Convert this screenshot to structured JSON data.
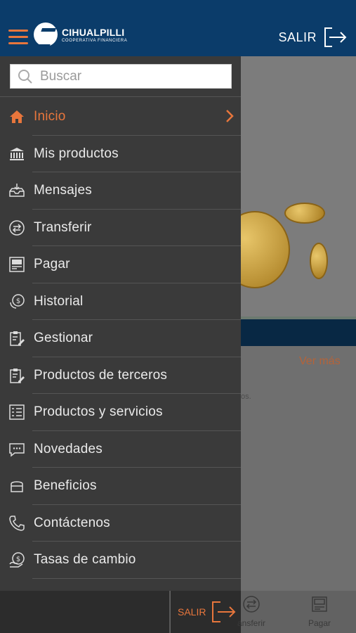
{
  "header": {
    "brand_title": "CIHUALPILLI",
    "brand_subtitle": "COOPERATIVA FINANCIERA",
    "exit_label": "SALIR"
  },
  "search": {
    "placeholder": "Buscar"
  },
  "menu": {
    "items": [
      {
        "label": "Inicio",
        "icon": "home-icon",
        "active": true
      },
      {
        "label": "Mis productos",
        "icon": "bank-icon"
      },
      {
        "label": "Mensajes",
        "icon": "inbox-icon"
      },
      {
        "label": "Transferir",
        "icon": "transfer-icon"
      },
      {
        "label": "Pagar",
        "icon": "pay-icon"
      },
      {
        "label": "Historial",
        "icon": "history-icon"
      },
      {
        "label": "Gestionar",
        "icon": "manage-icon"
      },
      {
        "label": "Productos de terceros",
        "icon": "third-party-icon"
      },
      {
        "label": "Productos y servicios",
        "icon": "services-icon"
      },
      {
        "label": "Novedades",
        "icon": "news-icon"
      },
      {
        "label": "Beneficios",
        "icon": "benefits-icon"
      },
      {
        "label": "Contáctenos",
        "icon": "phone-icon"
      },
      {
        "label": "Tasas de cambio",
        "icon": "exchange-icon"
      }
    ]
  },
  "background": {
    "ver_mas": "Ver más",
    "partial_text": "os."
  },
  "bottom_bar": {
    "exit_label": "SALIR",
    "tabs": [
      {
        "label": "ansferir",
        "icon": "transfer-icon"
      },
      {
        "label": "Pagar",
        "icon": "pay-icon"
      }
    ]
  },
  "colors": {
    "primary": "#0b3c6a",
    "accent": "#e8763c",
    "drawer": "#3a3a3a"
  }
}
